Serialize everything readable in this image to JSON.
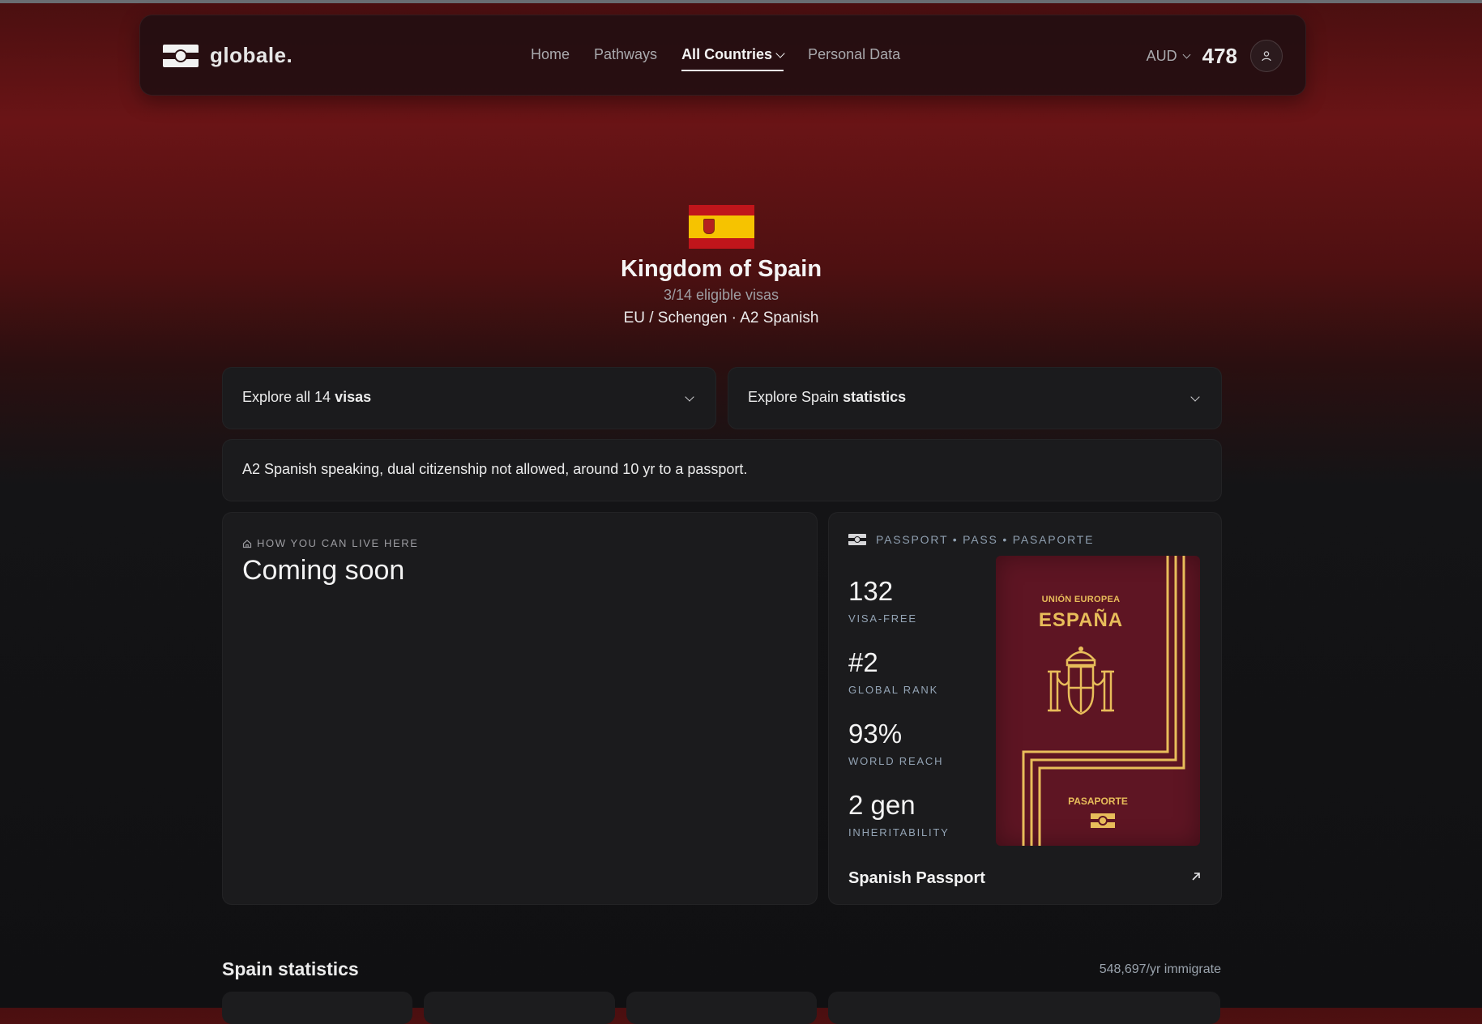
{
  "nav": {
    "brand": "globale.",
    "links": [
      {
        "label": "Home"
      },
      {
        "label": "Pathways"
      },
      {
        "label": "All Countries"
      },
      {
        "label": "Personal Data"
      }
    ],
    "currency": "AUD",
    "points": "478"
  },
  "country": {
    "name": "Kingdom of Spain",
    "eligible": "3/14 eligible visas",
    "zone": "EU / Schengen · A2 Spanish",
    "flag_colors": [
      "#c0151b",
      "#f6c300",
      "#c0151b"
    ]
  },
  "explore": {
    "visas": {
      "prefix": "Explore all 14 ",
      "bold": "visas"
    },
    "stats": {
      "prefix": "Explore Spain ",
      "bold": "statistics"
    }
  },
  "summary": "A2 Spanish speaking, dual citizenship not allowed, around 10 yr to a passport.",
  "live": {
    "icon": "home-icon",
    "heading": "HOW YOU CAN LIVE HERE",
    "status": "Coming soon"
  },
  "passport": {
    "heading": "PASSPORT • PASS • PASAPORTE",
    "stats": [
      {
        "value": "132",
        "label": "VISA-FREE"
      },
      {
        "value": "#2",
        "label": "GLOBAL RANK"
      },
      {
        "value": "93%",
        "label": "WORLD REACH"
      },
      {
        "value": "2 gen",
        "label": "INHERITABILITY"
      }
    ],
    "cover": {
      "union": "UNIÓN EUROPEA",
      "country": "ESPAÑA",
      "doc": "PASAPORTE",
      "color": "#5e1523",
      "gold": "#e8bd5a"
    },
    "name": "Spanish Passport",
    "link_icon": "arrow-up-right-icon"
  },
  "statistics": {
    "title": "Spain statistics",
    "immigration": "548,697/yr immigrate"
  },
  "theme": {
    "accent": "#6a1416",
    "card_bg": "#1b1b1d"
  }
}
